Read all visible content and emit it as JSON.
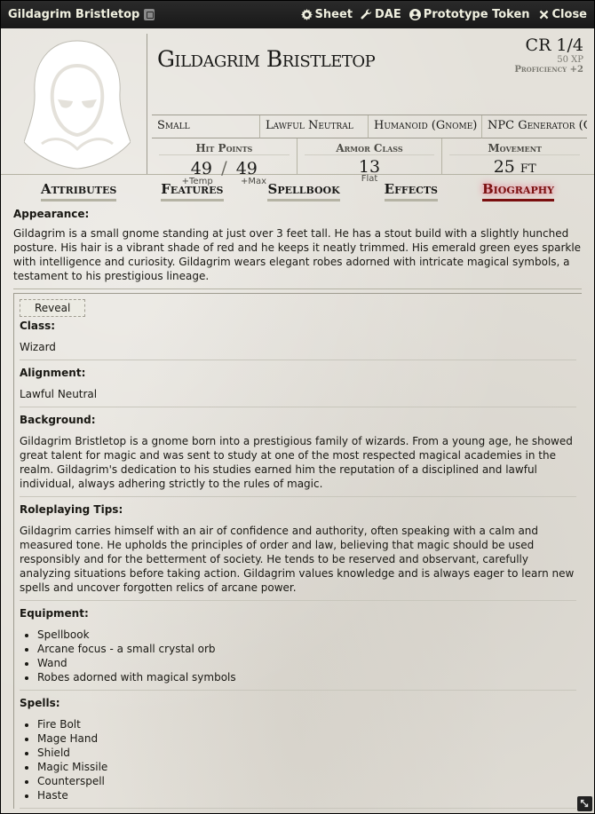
{
  "titlebar": {
    "title": "Gildagrim Bristletop",
    "buttons": [
      {
        "label": "Sheet",
        "icon": "gear-icon"
      },
      {
        "label": "DAE",
        "icon": "wrench-icon"
      },
      {
        "label": "Prototype Token",
        "icon": "user-circle-icon"
      },
      {
        "label": "Close",
        "icon": "close-icon"
      }
    ]
  },
  "header": {
    "name": "Gildagrim Bristletop",
    "cr": "CR 1/4",
    "xp": "50 XP",
    "proficiency": "Proficiency +2",
    "size": "Small",
    "alignment": "Lawful Neutral",
    "type": "Humanoid (Gnome)",
    "source": "NPC Generator (GPT)",
    "hit_points": {
      "label": "Hit Points",
      "value": "49",
      "max": "49",
      "temp_label": "+Temp",
      "max_label": "+Max"
    },
    "armor_class": {
      "label": "Armor Class",
      "value": "13",
      "sub": "Flat"
    },
    "movement": {
      "label": "Movement",
      "value": "25 ft"
    }
  },
  "tabs": [
    "Attributes",
    "Features",
    "Spellbook",
    "Effects",
    "Biography"
  ],
  "active_tab": "Biography",
  "appearance": {
    "label": "Appearance:",
    "text": "Gildagrim is a small gnome standing at just over 3 feet tall. He has a stout build with a slightly hunched posture. His hair is a vibrant shade of red and he keeps it neatly trimmed. His emerald green eyes sparkle with intelligence and curiosity. Gildagrim wears elegant robes adorned with intricate magical symbols, a testament to his prestigious lineage."
  },
  "reveal_label": "Reveal",
  "biography": {
    "class": {
      "label": "Class:",
      "text": "Wizard"
    },
    "alignment": {
      "label": "Alignment:",
      "text": "Lawful Neutral"
    },
    "background": {
      "label": "Background:",
      "text": "Gildagrim Bristletop is a gnome born into a prestigious family of wizards. From a young age, he showed great talent for magic and was sent to study at one of the most respected magical academies in the realm. Gildagrim's dedication to his studies earned him the reputation of a disciplined and lawful individual, always adhering strictly to the rules of magic."
    },
    "roleplaying": {
      "label": "Roleplaying Tips:",
      "text": "Gildagrim carries himself with an air of confidence and authority, often speaking with a calm and measured tone. He upholds the principles of order and law, believing that magic should be used responsibly and for the betterment of society. He tends to be reserved and observant, carefully analyzing situations before taking action. Gildagrim values knowledge and is always eager to learn new spells and uncover forgotten relics of arcane power."
    },
    "equipment": {
      "label": "Equipment:",
      "items": [
        "Spellbook",
        "Arcane focus - a small crystal orb",
        "Wand",
        "Robes adorned with magical symbols"
      ]
    },
    "spells": {
      "label": "Spells:",
      "items": [
        "Fire Bolt",
        "Mage Hand",
        "Shield",
        "Magic Missile",
        "Counterspell",
        "Haste"
      ]
    }
  },
  "colors": {
    "active_tab": "#7a1010",
    "titlebar": "#1e1e1e",
    "parchment": "#e4e1da"
  }
}
